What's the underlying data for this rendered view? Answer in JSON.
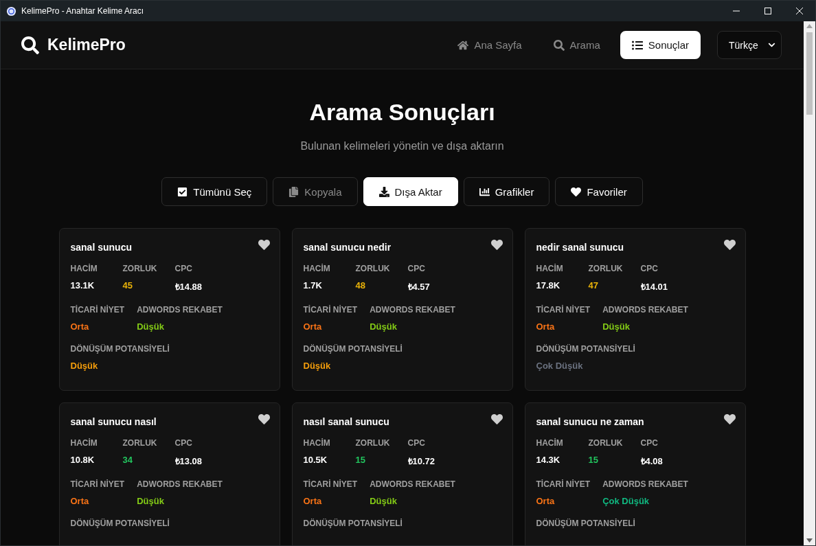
{
  "window": {
    "title": "KelimePro - Anahtar Kelime Aracı"
  },
  "header": {
    "logo": "KelimePro",
    "nav": [
      {
        "label": "Ana Sayfa",
        "selected": false
      },
      {
        "label": "Arama",
        "selected": false
      },
      {
        "label": "Sonuçlar",
        "selected": true
      }
    ],
    "language": "Türkçe"
  },
  "page": {
    "title": "Arama Sonuçları",
    "subtitle": "Bulunan kelimeleri yönetin ve dışa aktarın"
  },
  "toolbar": [
    {
      "label": "Tümünü Seç",
      "selected": false,
      "disabled": false
    },
    {
      "label": "Kopyala",
      "selected": false,
      "disabled": true
    },
    {
      "label": "Dışa Aktar",
      "selected": true,
      "disabled": false
    },
    {
      "label": "Grafikler",
      "selected": false,
      "disabled": false
    },
    {
      "label": "Favoriler",
      "selected": false,
      "disabled": false
    }
  ],
  "cards": [
    {
      "keyword": "sanal sunucu",
      "favorite": false,
      "rows": [
        [
          {
            "label": "HACİM",
            "value": "13.1K",
            "color": "#ffffff"
          },
          {
            "label": "ZORLUK",
            "value": "45",
            "color": "#eab308"
          },
          {
            "label": "CPC",
            "value": "₺14.88",
            "color": "#ffffff"
          }
        ],
        [
          {
            "label": "TİCARİ NİYET",
            "value": "Orta",
            "color": "#f97316"
          },
          {
            "label": "ADWORDS REKABET",
            "value": "Düşük",
            "color": "#84cc16"
          }
        ],
        [
          {
            "label": "DÖNÜŞÜM POTANSİYELİ",
            "value": "Düşük",
            "color": "#f59e0b"
          }
        ]
      ]
    },
    {
      "keyword": "sanal sunucu nedir",
      "favorite": false,
      "rows": [
        [
          {
            "label": "HACİM",
            "value": "1.7K",
            "color": "#ffffff"
          },
          {
            "label": "ZORLUK",
            "value": "48",
            "color": "#eab308"
          },
          {
            "label": "CPC",
            "value": "₺4.57",
            "color": "#ffffff"
          }
        ],
        [
          {
            "label": "TİCARİ NİYET",
            "value": "Orta",
            "color": "#f97316"
          },
          {
            "label": "ADWORDS REKABET",
            "value": "Düşük",
            "color": "#84cc16"
          }
        ],
        [
          {
            "label": "DÖNÜŞÜM POTANSİYELİ",
            "value": "Düşük",
            "color": "#f59e0b"
          }
        ]
      ]
    },
    {
      "keyword": "nedir sanal sunucu",
      "favorite": false,
      "rows": [
        [
          {
            "label": "HACİM",
            "value": "17.8K",
            "color": "#ffffff"
          },
          {
            "label": "ZORLUK",
            "value": "47",
            "color": "#eab308"
          },
          {
            "label": "CPC",
            "value": "₺14.01",
            "color": "#ffffff"
          }
        ],
        [
          {
            "label": "TİCARİ NİYET",
            "value": "Orta",
            "color": "#f97316"
          },
          {
            "label": "ADWORDS REKABET",
            "value": "Düşük",
            "color": "#84cc16"
          }
        ],
        [
          {
            "label": "DÖNÜŞÜM POTANSİYELİ",
            "value": "Çok Düşük",
            "color": "#6b7280"
          }
        ]
      ]
    },
    {
      "keyword": "sanal sunucu nasıl",
      "favorite": false,
      "rows": [
        [
          {
            "label": "HACİM",
            "value": "10.8K",
            "color": "#ffffff"
          },
          {
            "label": "ZORLUK",
            "value": "34",
            "color": "#22c55e"
          },
          {
            "label": "CPC",
            "value": "₺13.08",
            "color": "#ffffff"
          }
        ],
        [
          {
            "label": "TİCARİ NİYET",
            "value": "Orta",
            "color": "#f97316"
          },
          {
            "label": "ADWORDS REKABET",
            "value": "Düşük",
            "color": "#84cc16"
          }
        ],
        [
          {
            "label": "DÖNÜŞÜM POTANSİYELİ"
          }
        ]
      ]
    },
    {
      "keyword": "nasıl sanal sunucu",
      "favorite": false,
      "rows": [
        [
          {
            "label": "HACİM",
            "value": "10.5K",
            "color": "#ffffff"
          },
          {
            "label": "ZORLUK",
            "value": "15",
            "color": "#22c55e"
          },
          {
            "label": "CPC",
            "value": "₺10.72",
            "color": "#ffffff"
          }
        ],
        [
          {
            "label": "TİCARİ NİYET",
            "value": "Orta",
            "color": "#f97316"
          },
          {
            "label": "ADWORDS REKABET",
            "value": "Düşük",
            "color": "#84cc16"
          }
        ],
        [
          {
            "label": "DÖNÜŞÜM POTANSİYELİ"
          }
        ]
      ]
    },
    {
      "keyword": "sanal sunucu ne zaman",
      "favorite": false,
      "rows": [
        [
          {
            "label": "HACİM",
            "value": "14.3K",
            "color": "#ffffff"
          },
          {
            "label": "ZORLUK",
            "value": "15",
            "color": "#22c55e"
          },
          {
            "label": "CPC",
            "value": "₺4.08",
            "color": "#ffffff"
          }
        ],
        [
          {
            "label": "TİCARİ NİYET",
            "value": "Orta",
            "color": "#f97316"
          },
          {
            "label": "ADWORDS REKABET",
            "value": "Çok Düşük",
            "color": "#10b981"
          }
        ],
        [
          {
            "label": "DÖNÜŞÜM POTANSİYELİ"
          }
        ]
      ]
    }
  ]
}
